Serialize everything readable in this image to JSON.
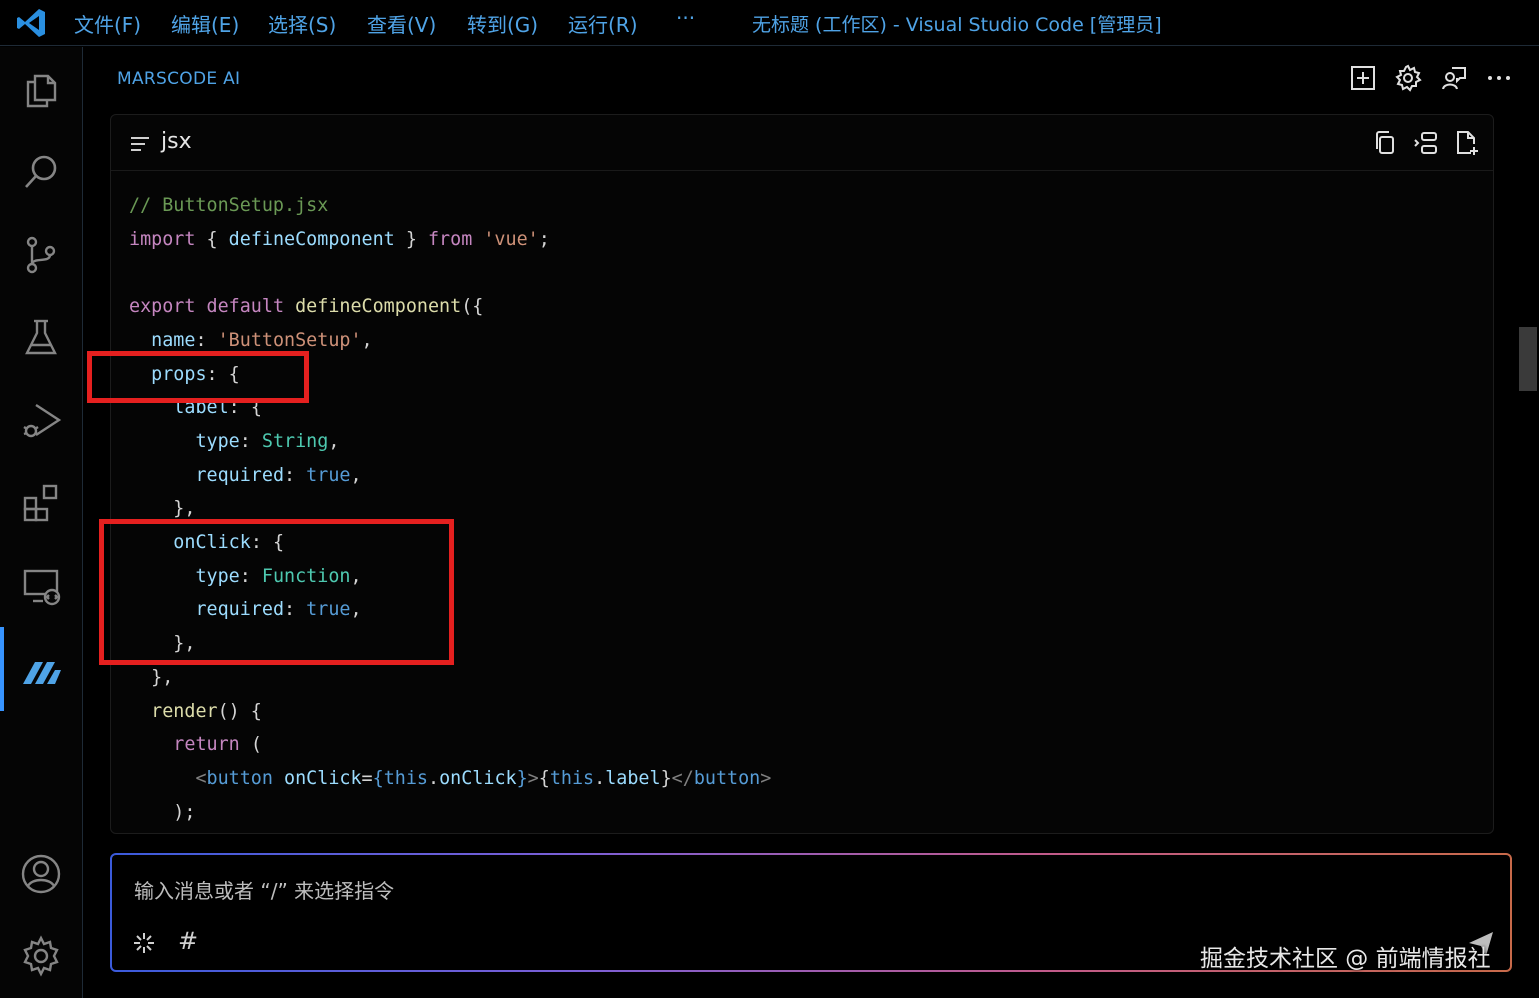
{
  "titlebar": {
    "menus": [
      "文件(F)",
      "编辑(E)",
      "选择(S)",
      "查看(V)",
      "转到(G)",
      "运行(R)",
      "···"
    ],
    "window_title": "无标题 (工作区) - Visual Studio Code [管理员]"
  },
  "activitybar": {
    "items": [
      "explorer-icon",
      "search-icon",
      "source-control-icon",
      "testing-icon",
      "run-debug-icon",
      "extensions-icon",
      "remote-explorer-icon",
      "marscode-icon",
      "account-icon",
      "settings-gear-icon"
    ],
    "active": "marscode-icon"
  },
  "panel": {
    "title": "MARSCODE AI",
    "actions": [
      "new-chat-icon",
      "gear-icon",
      "feedback-icon",
      "more-icon"
    ]
  },
  "code_block": {
    "language": "jsx",
    "actions": [
      "copy-icon",
      "insert-icon",
      "new-file-icon"
    ],
    "lines": [
      "// ButtonSetup.jsx",
      "import { defineComponent } from 'vue';",
      "",
      "export default defineComponent({",
      "  name: 'ButtonSetup',",
      "  props: {",
      "    label: {",
      "      type: String,",
      "      required: true,",
      "    },",
      "    onClick: {",
      "      type: Function,",
      "      required: true,",
      "    },",
      "  },",
      "  render() {",
      "    return (",
      "      <button onClick={this.onClick}>{this.label}</button>",
      "    );"
    ]
  },
  "chat": {
    "placeholder": "输入消息或者 “/” 来选择指令",
    "hash_symbol": "#"
  },
  "watermark": "掘金技术社区 @ 前端情报社",
  "colors": {
    "accent": "#4fa3e6",
    "highlight_box": "#e5201f"
  }
}
